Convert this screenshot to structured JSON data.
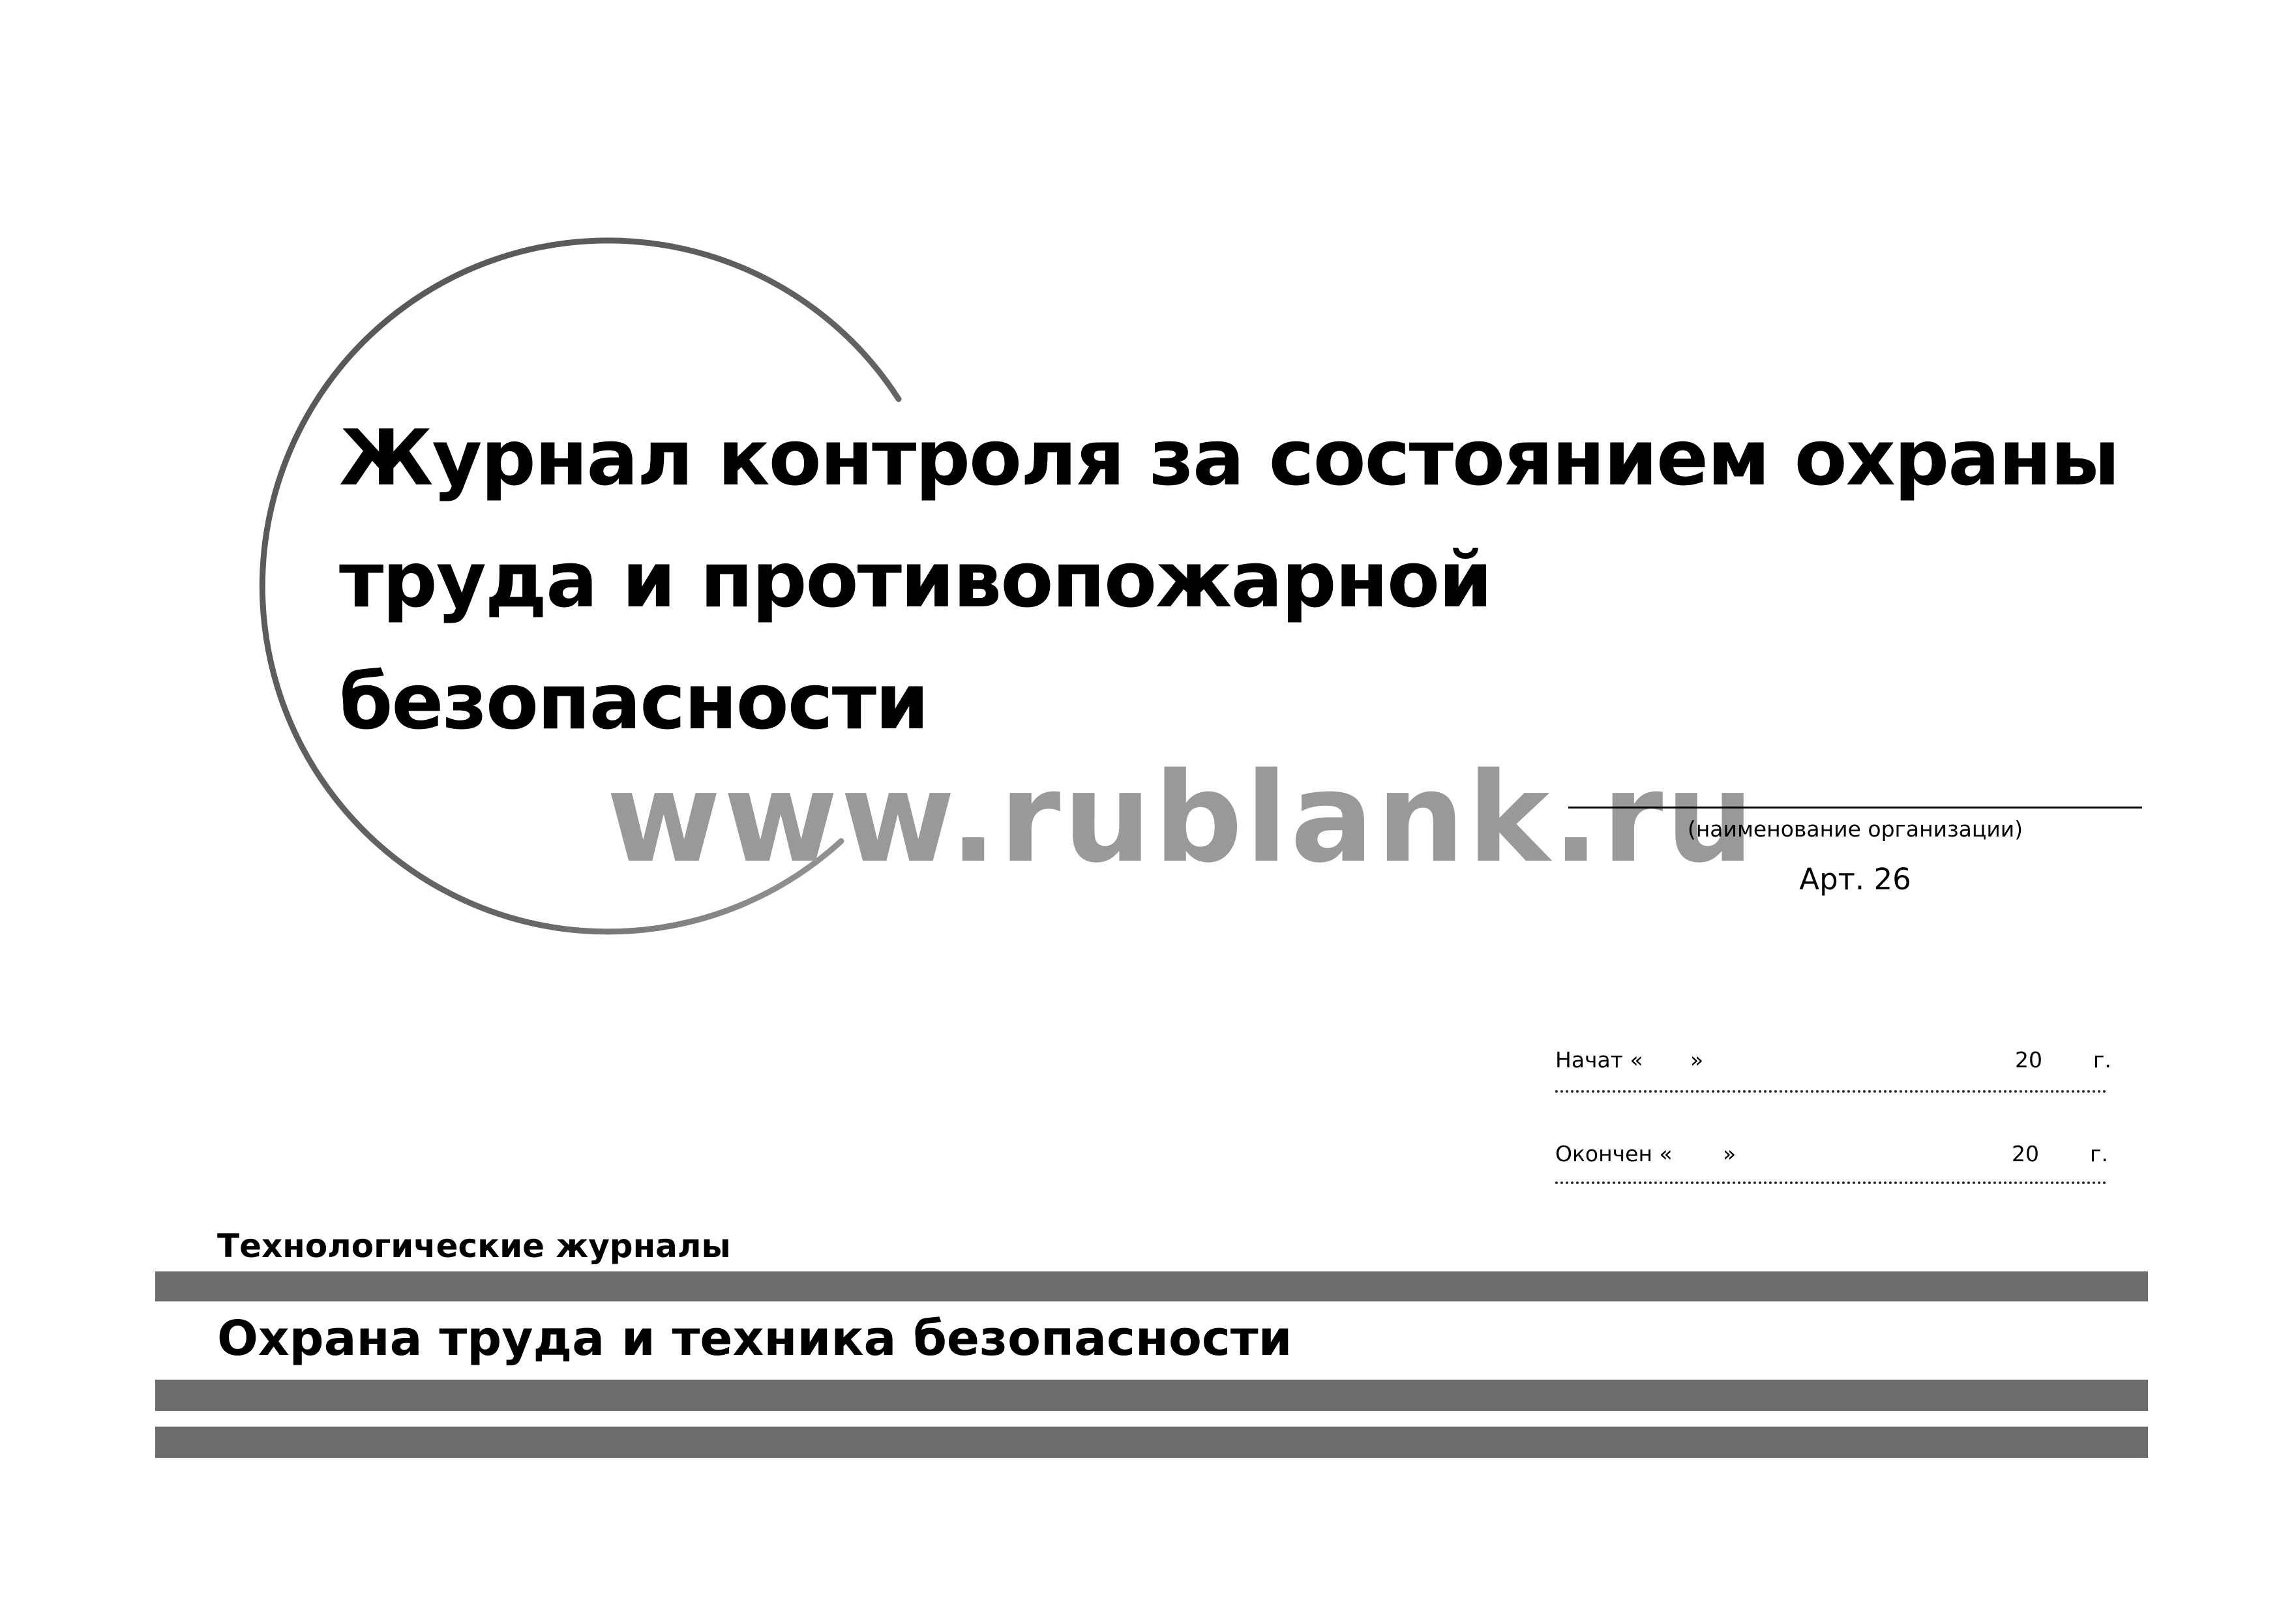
{
  "title": {
    "lines": [
      "Журнал контроля за состоянием охраны",
      "труда и противопожарной",
      "безопасности"
    ]
  },
  "watermark": "www.rublank.ru",
  "organization": {
    "caption": "(наименование организации)"
  },
  "article": "Арт. 26",
  "dates": {
    "started": {
      "label": "Начат «",
      "close_quote": "»",
      "year": "20",
      "suffix": "г."
    },
    "finished": {
      "label": "Окончен «",
      "close_quote": "»",
      "year": "20",
      "suffix": "г."
    }
  },
  "category": {
    "section": "Технологические журналы",
    "subsection": "Охрана труда и техника безопасности"
  },
  "colors": {
    "bars": "#6d6d6d",
    "watermark": "#999999"
  }
}
